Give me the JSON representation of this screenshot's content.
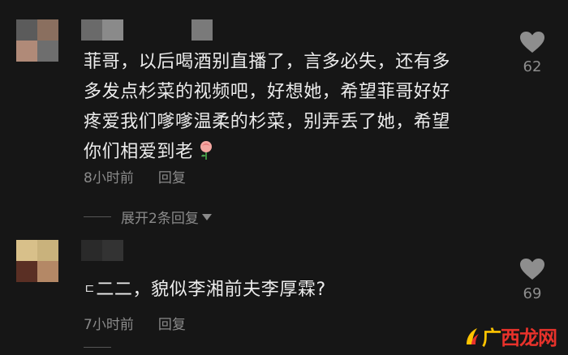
{
  "comment1": {
    "text": "菲哥，以后喝酒别直播了，言多必失，还有多\n多发点杉菜的视频吧，好想她，希望菲哥好好\n疼爱我们嗲嗲温柔的杉菜，别弄丢了她，希望\n你们相爱到老",
    "emoji": "rose-emoji",
    "time": "8小时前",
    "reply_label": "回复",
    "expand_label": "展开2条回复",
    "likes": "62"
  },
  "comment2": {
    "text": "二二，貌似李湘前夫李厚霖?",
    "text_prefix": "ㄷ",
    "time": "7小时前",
    "reply_label": "回复",
    "likes": "69"
  },
  "watermark": {
    "text_a": "广",
    "text_b": "西龙网"
  },
  "colors": {
    "background": "#161616",
    "text": "#ececec",
    "meta": "#8a8a8a",
    "watermark_yellow": "#ffc400",
    "watermark_red": "#e8322b"
  }
}
